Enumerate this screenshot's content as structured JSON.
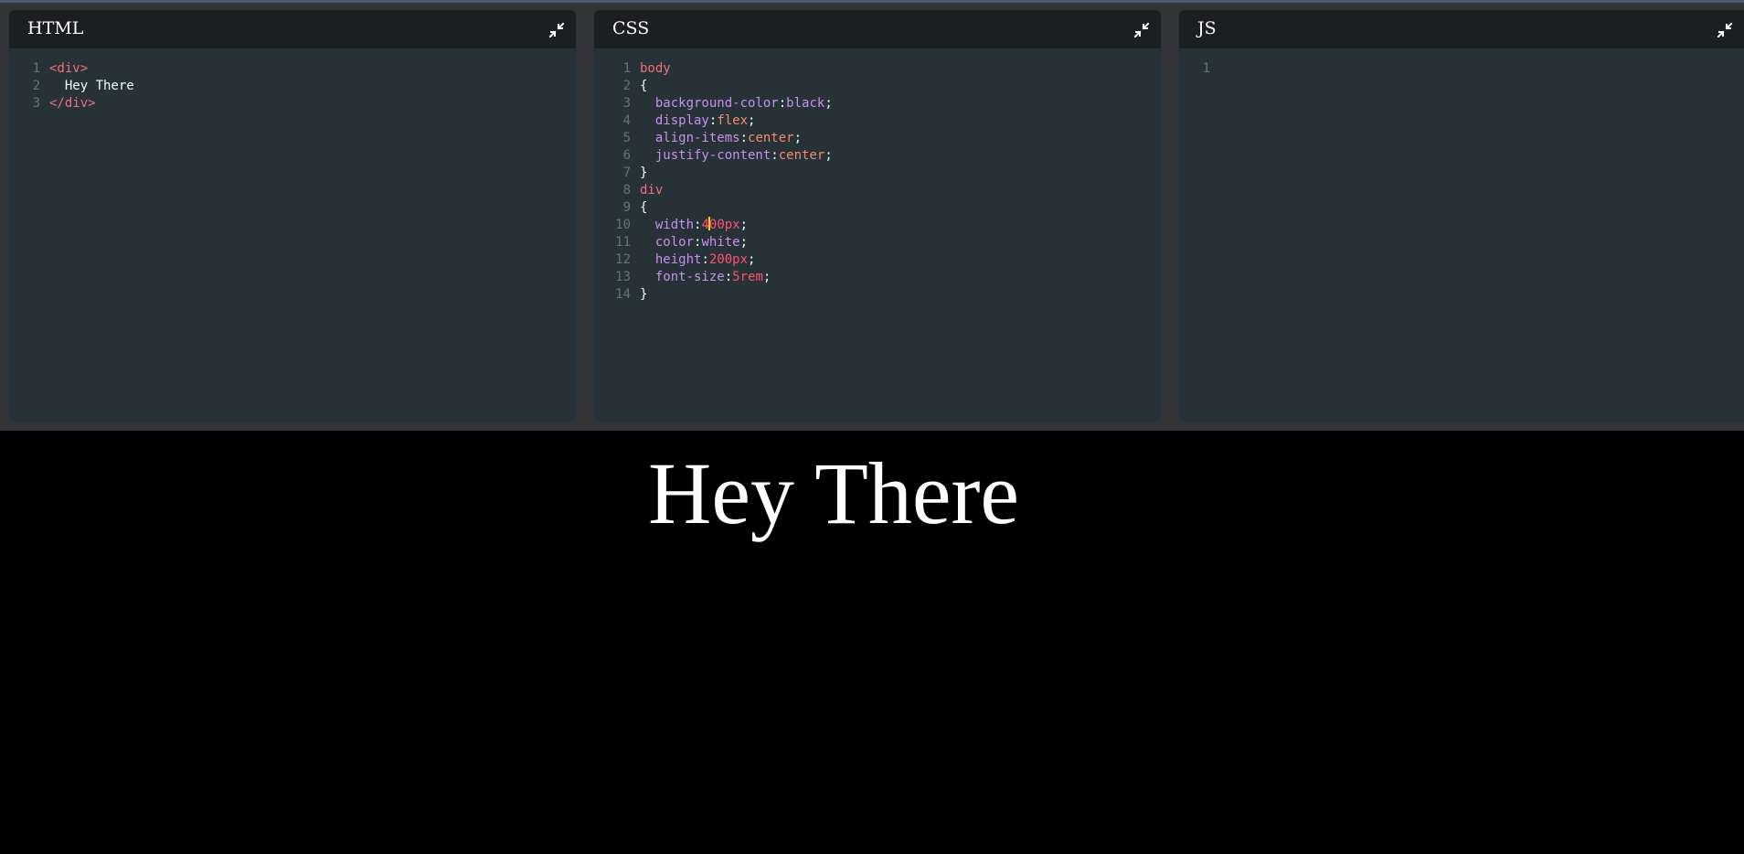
{
  "panels": {
    "html": {
      "title": "HTML",
      "lines": [
        {
          "n": "1",
          "parts": [
            [
              "tag",
              "<div>"
            ]
          ]
        },
        {
          "n": "2",
          "parts": [
            [
              "txt",
              "  Hey There"
            ]
          ]
        },
        {
          "n": "3",
          "parts": [
            [
              "tag",
              "</div>"
            ]
          ]
        }
      ]
    },
    "css": {
      "title": "CSS",
      "lines": [
        {
          "n": "1",
          "parts": [
            [
              "tag",
              "body"
            ]
          ]
        },
        {
          "n": "2",
          "parts": [
            [
              "txt",
              "{"
            ]
          ]
        },
        {
          "n": "3",
          "parts": [
            [
              "txt",
              "  "
            ],
            [
              "prop",
              "background-color"
            ],
            [
              "txt",
              ":"
            ],
            [
              "prop",
              "black"
            ],
            [
              "txt",
              ";"
            ]
          ]
        },
        {
          "n": "4",
          "parts": [
            [
              "txt",
              "  "
            ],
            [
              "prop",
              "display"
            ],
            [
              "txt",
              ":"
            ],
            [
              "val",
              "flex"
            ],
            [
              "txt",
              ";"
            ]
          ]
        },
        {
          "n": "5",
          "parts": [
            [
              "txt",
              "  "
            ],
            [
              "prop",
              "align-items"
            ],
            [
              "txt",
              ":"
            ],
            [
              "val",
              "center"
            ],
            [
              "txt",
              ";"
            ]
          ]
        },
        {
          "n": "6",
          "parts": [
            [
              "txt",
              "  "
            ],
            [
              "prop",
              "justify-content"
            ],
            [
              "txt",
              ":"
            ],
            [
              "val",
              "center"
            ],
            [
              "txt",
              ";"
            ]
          ]
        },
        {
          "n": "7",
          "parts": [
            [
              "txt",
              "}"
            ]
          ]
        },
        {
          "n": "8",
          "parts": [
            [
              "tag",
              "div"
            ]
          ]
        },
        {
          "n": "9",
          "parts": [
            [
              "txt",
              "{"
            ]
          ]
        },
        {
          "n": "10",
          "parts": [
            [
              "txt",
              "  "
            ],
            [
              "prop",
              "width"
            ],
            [
              "txt",
              ":"
            ],
            [
              "num",
              "4"
            ],
            [
              "caret",
              ""
            ],
            [
              "num",
              "00px"
            ],
            [
              "txt",
              ";"
            ]
          ]
        },
        {
          "n": "11",
          "parts": [
            [
              "txt",
              "  "
            ],
            [
              "prop",
              "color"
            ],
            [
              "txt",
              ":"
            ],
            [
              "prop",
              "white"
            ],
            [
              "txt",
              ";"
            ]
          ]
        },
        {
          "n": "12",
          "parts": [
            [
              "txt",
              "  "
            ],
            [
              "prop",
              "height"
            ],
            [
              "txt",
              ":"
            ],
            [
              "num",
              "200px"
            ],
            [
              "txt",
              ";"
            ]
          ]
        },
        {
          "n": "13",
          "parts": [
            [
              "txt",
              "  "
            ],
            [
              "prop",
              "font-size"
            ],
            [
              "txt",
              ":"
            ],
            [
              "num",
              "5rem"
            ],
            [
              "txt",
              ";"
            ]
          ]
        },
        {
          "n": "14",
          "parts": [
            [
              "txt",
              "}"
            ]
          ]
        }
      ]
    },
    "js": {
      "title": "JS",
      "lines": [
        {
          "n": "1",
          "parts": []
        }
      ]
    }
  },
  "preview": {
    "text": "Hey There",
    "background": "#000000",
    "color": "#ffffff"
  },
  "icons": {
    "collapse": "collapse-arrows-icon"
  }
}
